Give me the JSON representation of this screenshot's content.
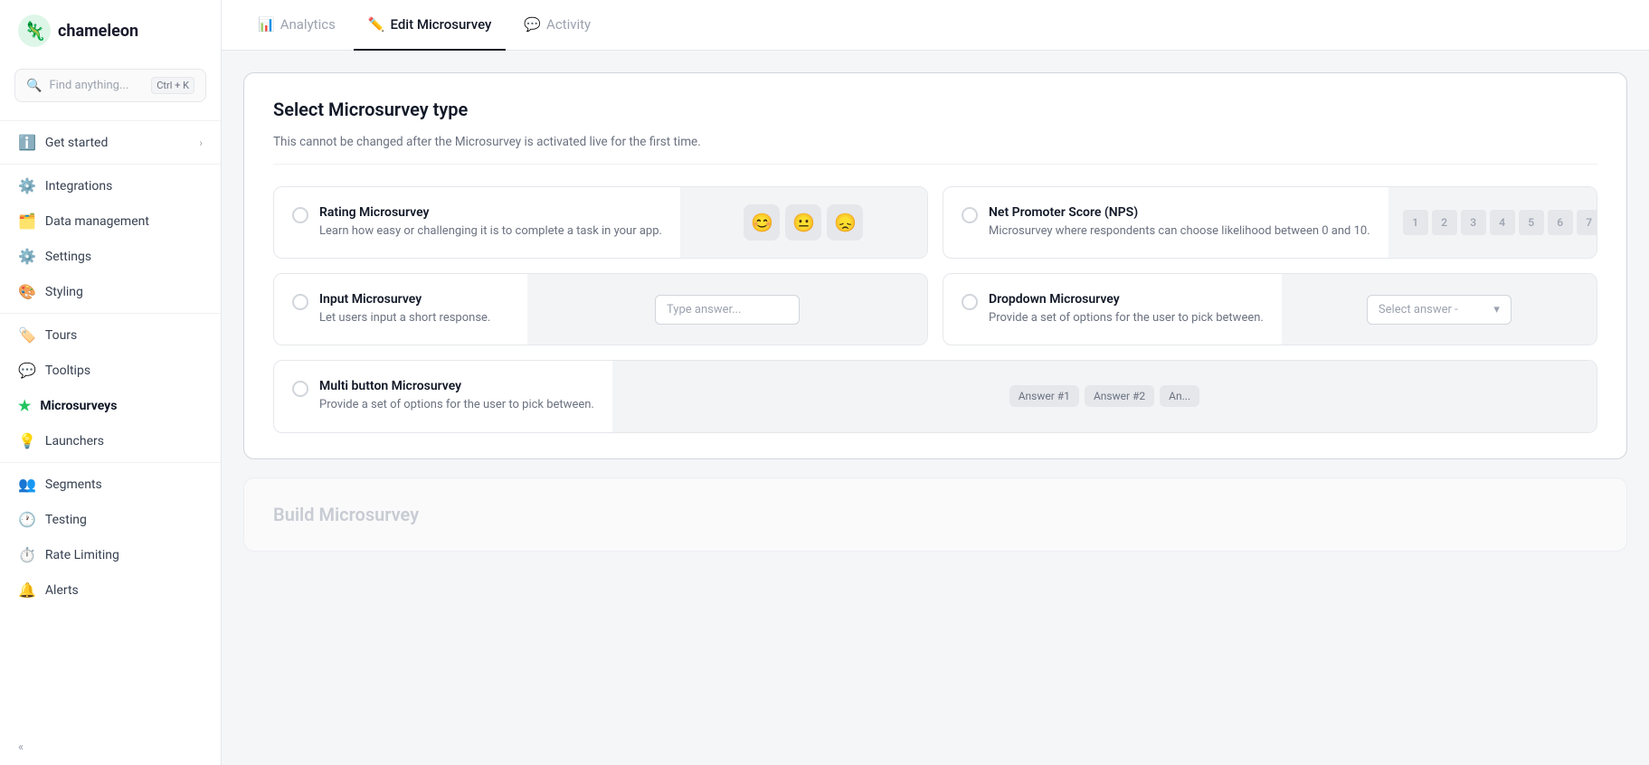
{
  "brand": {
    "name": "chameleon",
    "logo_alt": "Chameleon logo"
  },
  "search": {
    "placeholder": "Find anything...",
    "shortcut": "Ctrl + K"
  },
  "sidebar": {
    "items": [
      {
        "id": "get-started",
        "label": "Get started",
        "icon": "ℹ",
        "has_chevron": true
      },
      {
        "id": "integrations",
        "label": "Integrations",
        "icon": "⚙"
      },
      {
        "id": "data-management",
        "label": "Data management",
        "icon": "🗂"
      },
      {
        "id": "settings",
        "label": "Settings",
        "icon": "⚙"
      },
      {
        "id": "styling",
        "label": "Styling",
        "icon": "🎨"
      },
      {
        "id": "tours",
        "label": "Tours",
        "icon": "🏷"
      },
      {
        "id": "tooltips",
        "label": "Tooltips",
        "icon": "💬"
      },
      {
        "id": "microsurveys",
        "label": "Microsurveys",
        "icon": "⭐",
        "active": true
      },
      {
        "id": "launchers",
        "label": "Launchers",
        "icon": "💡"
      },
      {
        "id": "segments",
        "label": "Segments",
        "icon": "👥"
      },
      {
        "id": "testing",
        "label": "Testing",
        "icon": "🕐"
      },
      {
        "id": "rate-limiting",
        "label": "Rate Limiting",
        "icon": "⏱"
      },
      {
        "id": "alerts",
        "label": "Alerts",
        "icon": "🔔"
      }
    ]
  },
  "tabs": [
    {
      "id": "analytics",
      "label": "Analytics",
      "icon": "📊"
    },
    {
      "id": "edit-microsurvey",
      "label": "Edit Microsurvey",
      "icon": "✏",
      "active": true
    },
    {
      "id": "activity",
      "label": "Activity",
      "icon": "💬"
    }
  ],
  "select_microsurvey": {
    "title": "Select Microsurvey type",
    "subtitle": "This cannot be changed after the Microsurvey is activated live for the first time.",
    "options": [
      {
        "id": "rating",
        "title": "Rating Microsurvey",
        "desc": "Learn how easy or challenging it is to complete a task in your app.",
        "preview_type": "emoji"
      },
      {
        "id": "nps",
        "title": "Net Promoter Score (NPS)",
        "desc": "Microsurvey where respondents can choose likelihood between 0 and 10.",
        "preview_type": "nps",
        "nps_numbers": [
          "1",
          "2",
          "3",
          "4",
          "5",
          "6",
          "7"
        ]
      },
      {
        "id": "input",
        "title": "Input Microsurvey",
        "desc": "Let users input a short response.",
        "preview_type": "input",
        "input_placeholder": "Type answer..."
      },
      {
        "id": "dropdown",
        "title": "Dropdown Microsurvey",
        "desc": "Provide a set of options for the user to pick between.",
        "preview_type": "dropdown",
        "dropdown_placeholder": "Select answer -"
      },
      {
        "id": "multi-button",
        "title": "Multi button Microsurvey",
        "desc": "Provide a set of options for the user to pick between.",
        "preview_type": "multi-button",
        "buttons": [
          "Answer #1",
          "Answer #2",
          "An..."
        ]
      }
    ]
  },
  "build_section": {
    "title": "Build Microsurvey"
  }
}
